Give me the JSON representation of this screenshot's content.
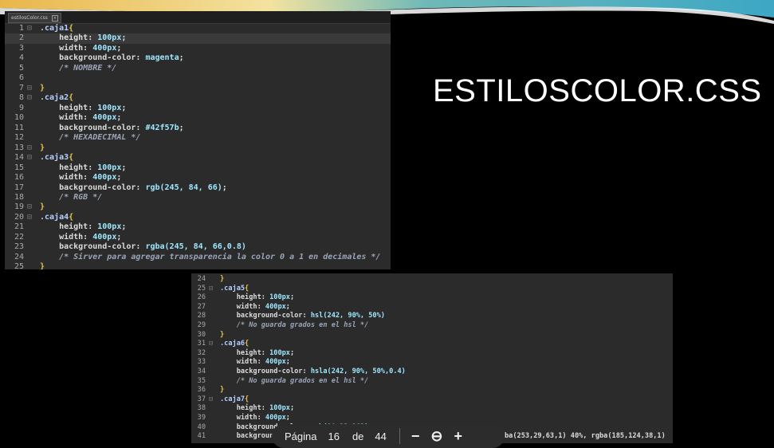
{
  "slide": {
    "title": "ESTILOSCOLOR.CSS"
  },
  "editor1": {
    "tab": "estilosColor.css",
    "lines": [
      {
        "n": "1",
        "fold": "⊟",
        "parts": [
          [
            "sel",
            ".caja1"
          ],
          [
            "brace",
            "{"
          ]
        ]
      },
      {
        "n": "2",
        "fold": "",
        "parts": [
          [
            "prop",
            "    height: "
          ],
          [
            "kw",
            "100px"
          ],
          [
            "val",
            ";"
          ]
        ]
      },
      {
        "n": "3",
        "fold": "",
        "parts": [
          [
            "prop",
            "    width: "
          ],
          [
            "kw",
            "400px"
          ],
          [
            "val",
            ";"
          ]
        ]
      },
      {
        "n": "4",
        "fold": "",
        "parts": [
          [
            "prop",
            "    background-color: "
          ],
          [
            "kw",
            "magenta"
          ],
          [
            "val",
            ";"
          ]
        ]
      },
      {
        "n": "5",
        "fold": "",
        "parts": [
          [
            "cmt",
            "    /* NOMBRE */"
          ]
        ]
      },
      {
        "n": "6",
        "fold": "",
        "parts": [
          [
            "val",
            ""
          ]
        ]
      },
      {
        "n": "7",
        "fold": "⊟",
        "parts": [
          [
            "brace",
            "}"
          ]
        ]
      },
      {
        "n": "8",
        "fold": "⊟",
        "parts": [
          [
            "sel",
            ".caja2"
          ],
          [
            "brace",
            "{"
          ]
        ]
      },
      {
        "n": "9",
        "fold": "",
        "parts": [
          [
            "prop",
            "    height: "
          ],
          [
            "kw",
            "100px"
          ],
          [
            "val",
            ";"
          ]
        ]
      },
      {
        "n": "10",
        "fold": "",
        "parts": [
          [
            "prop",
            "    width: "
          ],
          [
            "kw",
            "400px"
          ],
          [
            "val",
            ";"
          ]
        ]
      },
      {
        "n": "11",
        "fold": "",
        "parts": [
          [
            "prop",
            "    background-color: "
          ],
          [
            "kw",
            "#42f57b"
          ],
          [
            "val",
            ";"
          ]
        ]
      },
      {
        "n": "12",
        "fold": "",
        "parts": [
          [
            "cmt",
            "    /* HEXADECIMAL */"
          ]
        ]
      },
      {
        "n": "13",
        "fold": "⊟",
        "parts": [
          [
            "brace",
            "}"
          ]
        ]
      },
      {
        "n": "14",
        "fold": "⊟",
        "parts": [
          [
            "sel",
            ".caja3"
          ],
          [
            "brace",
            "{"
          ]
        ]
      },
      {
        "n": "15",
        "fold": "",
        "parts": [
          [
            "prop",
            "    height: "
          ],
          [
            "kw",
            "100px"
          ],
          [
            "val",
            ";"
          ]
        ]
      },
      {
        "n": "16",
        "fold": "",
        "parts": [
          [
            "prop",
            "    width: "
          ],
          [
            "kw",
            "400px"
          ],
          [
            "val",
            ";"
          ]
        ]
      },
      {
        "n": "17",
        "fold": "",
        "parts": [
          [
            "prop",
            "    background-color: "
          ],
          [
            "kw",
            "rgb(245, 84, 66)"
          ],
          [
            "val",
            ";"
          ]
        ]
      },
      {
        "n": "18",
        "fold": "",
        "parts": [
          [
            "cmt",
            "    /* RGB */"
          ]
        ]
      },
      {
        "n": "19",
        "fold": "⊟",
        "parts": [
          [
            "brace",
            "}"
          ]
        ]
      },
      {
        "n": "20",
        "fold": "⊟",
        "parts": [
          [
            "sel",
            ".caja4"
          ],
          [
            "brace",
            "{"
          ]
        ]
      },
      {
        "n": "21",
        "fold": "",
        "parts": [
          [
            "prop",
            "    height: "
          ],
          [
            "kw",
            "100px"
          ],
          [
            "val",
            ";"
          ]
        ]
      },
      {
        "n": "22",
        "fold": "",
        "parts": [
          [
            "prop",
            "    width: "
          ],
          [
            "kw",
            "400px"
          ],
          [
            "val",
            ";"
          ]
        ]
      },
      {
        "n": "23",
        "fold": "",
        "parts": [
          [
            "prop",
            "    background-color: "
          ],
          [
            "kw",
            "rgba(245, 84, 66,0.8)"
          ]
        ]
      },
      {
        "n": "24",
        "fold": "",
        "parts": [
          [
            "cmt",
            "    /* Sirver para agregar transparencia la color 0 a 1 en decimales */"
          ]
        ]
      },
      {
        "n": "25",
        "fold": "",
        "parts": [
          [
            "brace",
            "}"
          ]
        ]
      }
    ]
  },
  "editor2": {
    "lines": [
      {
        "n": "24",
        "fold": "",
        "parts": [
          [
            "brace",
            "}"
          ]
        ]
      },
      {
        "n": "25",
        "fold": "⊟",
        "parts": [
          [
            "sel",
            ".caja5"
          ],
          [
            "brace",
            "{"
          ]
        ]
      },
      {
        "n": "26",
        "fold": "",
        "parts": [
          [
            "prop",
            "    height: "
          ],
          [
            "kw",
            "100px"
          ],
          [
            "val",
            ";"
          ]
        ]
      },
      {
        "n": "27",
        "fold": "",
        "parts": [
          [
            "prop",
            "    width: "
          ],
          [
            "kw",
            "400px"
          ],
          [
            "val",
            ";"
          ]
        ]
      },
      {
        "n": "28",
        "fold": "",
        "parts": [
          [
            "prop",
            "    background-color: "
          ],
          [
            "kw",
            "hsl(242, 90%, 50%)"
          ]
        ]
      },
      {
        "n": "29",
        "fold": "",
        "parts": [
          [
            "cmt",
            "    /* No guarda grados en el hsl */"
          ]
        ]
      },
      {
        "n": "30",
        "fold": "",
        "parts": [
          [
            "brace",
            "}"
          ]
        ]
      },
      {
        "n": "31",
        "fold": "⊟",
        "parts": [
          [
            "sel",
            ".caja6"
          ],
          [
            "brace",
            "{"
          ]
        ]
      },
      {
        "n": "32",
        "fold": "",
        "parts": [
          [
            "prop",
            "    height: "
          ],
          [
            "kw",
            "100px"
          ],
          [
            "val",
            ";"
          ]
        ]
      },
      {
        "n": "33",
        "fold": "",
        "parts": [
          [
            "prop",
            "    width: "
          ],
          [
            "kw",
            "400px"
          ],
          [
            "val",
            ";"
          ]
        ]
      },
      {
        "n": "34",
        "fold": "",
        "parts": [
          [
            "prop",
            "    background-color: "
          ],
          [
            "kw",
            "hsla(242, 90%, 50%,0.4)"
          ]
        ]
      },
      {
        "n": "35",
        "fold": "",
        "parts": [
          [
            "cmt",
            "    /* No guarda grados en el hsl */"
          ]
        ]
      },
      {
        "n": "36",
        "fold": "",
        "parts": [
          [
            "brace",
            "}"
          ]
        ]
      },
      {
        "n": "37",
        "fold": "⊟",
        "parts": [
          [
            "sel",
            ".caja7"
          ],
          [
            "brace",
            "{"
          ]
        ]
      },
      {
        "n": "38",
        "fold": "",
        "parts": [
          [
            "prop",
            "    height: "
          ],
          [
            "kw",
            "100px"
          ],
          [
            "val",
            ";"
          ]
        ]
      },
      {
        "n": "39",
        "fold": "",
        "parts": [
          [
            "prop",
            "    width: "
          ],
          [
            "kw",
            "400px"
          ],
          [
            "val",
            ";"
          ]
        ]
      },
      {
        "n": "40",
        "fold": "",
        "parts": [
          [
            "prop",
            "    background-color: "
          ],
          [
            "kw",
            "rgb(90,13,163)"
          ],
          [
            "val",
            ";"
          ]
        ]
      },
      {
        "n": "41",
        "fold": "",
        "parts": [
          [
            "prop",
            "    background-image: linear-gradient(90deg, rgba(90,13,163,1) 0%, rgba(253,29,63,1) 40%, rgba(185,124,38,1)"
          ]
        ]
      }
    ]
  },
  "pager": {
    "label": "Página",
    "current": "16",
    "of": "de",
    "total": "44",
    "zoom_out": "−",
    "zoom_icon": "⊖",
    "zoom_in": "+"
  }
}
